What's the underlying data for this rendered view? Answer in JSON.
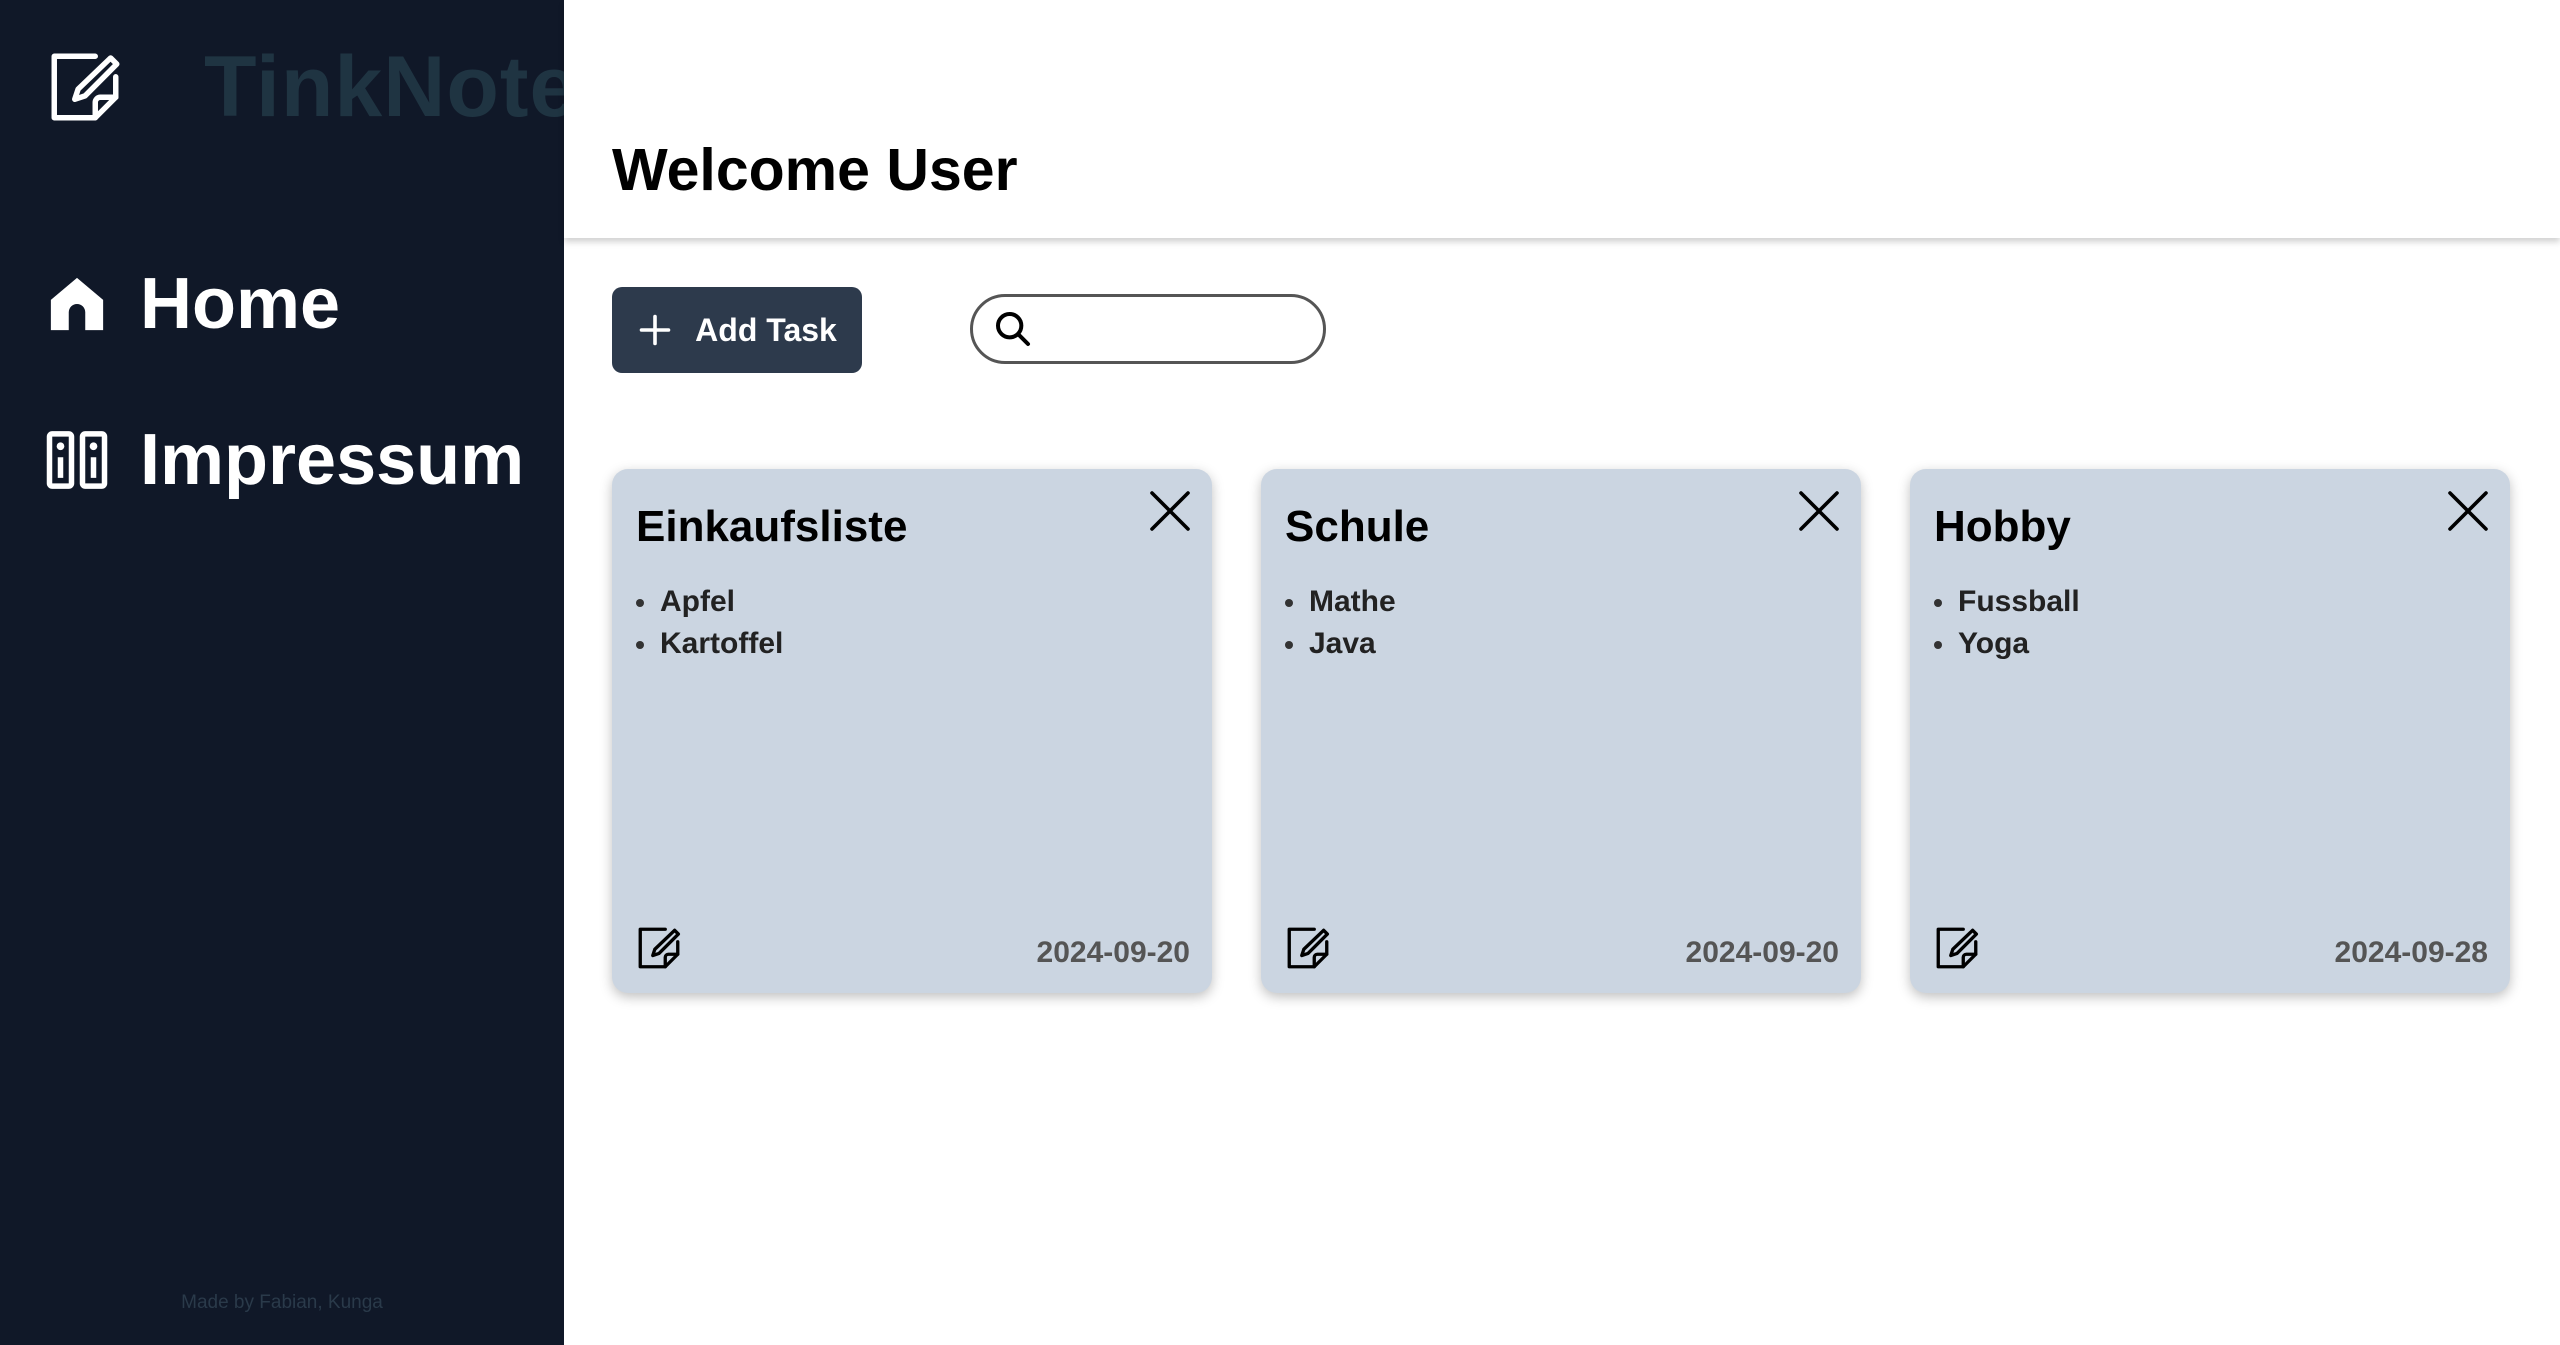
{
  "sidebar": {
    "brand": "TinkNote",
    "nav": [
      {
        "label": "Home",
        "icon": "home-icon"
      },
      {
        "label": "Impressum",
        "icon": "info-columns-icon"
      }
    ],
    "footer": "Made by Fabian, Kunga"
  },
  "header": {
    "title": "Welcome User"
  },
  "toolbar": {
    "add_label": "Add Task",
    "search_placeholder": "",
    "search_value": ""
  },
  "cards": [
    {
      "title": "Einkaufsliste",
      "items": [
        "Apfel",
        "Kartoffel"
      ],
      "date": "2024-09-20"
    },
    {
      "title": "Schule",
      "items": [
        "Mathe",
        "Java"
      ],
      "date": "2024-09-20"
    },
    {
      "title": "Hobby",
      "items": [
        "Fussball",
        "Yoga"
      ],
      "date": "2024-09-28"
    }
  ],
  "colors": {
    "sidebar_bg": "#101828",
    "brand_text": "#1f3442",
    "card_bg": "#cbd5e1",
    "button_bg": "#2d3a4c"
  }
}
